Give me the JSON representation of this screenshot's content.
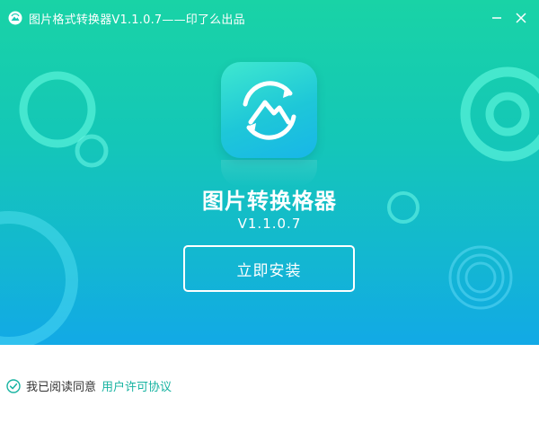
{
  "window": {
    "title": "图片格式转换器V1.1.0.7——印了么出品"
  },
  "app": {
    "name": "图片转换格器",
    "version": "V1.1.0.7"
  },
  "install": {
    "label": "立即安装"
  },
  "agreement": {
    "text": "我已阅读同意",
    "link": "用户许可协议",
    "checked": true
  },
  "colors": {
    "gradient_top": "#19d3a6",
    "gradient_bottom": "#12a9e6",
    "link": "#17b3a1",
    "text": "#333333"
  },
  "icons": [
    "app-logo-icon",
    "minimize-icon",
    "close-icon",
    "check-circle-icon"
  ]
}
